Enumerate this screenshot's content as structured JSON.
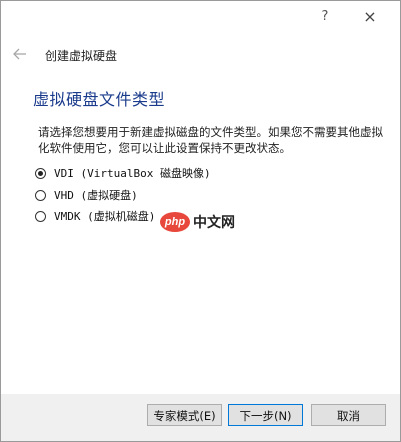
{
  "titlebar": {
    "help_label": "?",
    "close_label": "×"
  },
  "header": {
    "back_icon": "back-arrow-icon",
    "title": "创建虚拟硬盘"
  },
  "main": {
    "heading": "虚拟硬盘文件类型",
    "description": "请选择您想要用于新建虚拟磁盘的文件类型。如果您不需要其他虚拟化软件使用它，您可以让此设置保持不更改状态。",
    "options": [
      {
        "label": "VDI (VirtualBox 磁盘映像)",
        "checked": true
      },
      {
        "label": "VHD (虚拟硬盘)",
        "checked": false
      },
      {
        "label": "VMDK (虚拟机磁盘)",
        "checked": false
      }
    ]
  },
  "watermark": {
    "logo_text": "php",
    "text": "中文网"
  },
  "footer": {
    "expert_label": "专家模式(E)",
    "next_label": "下一步(N)",
    "cancel_label": "取消"
  },
  "colors": {
    "heading": "#1a3b8c",
    "primary_border": "#0078d7",
    "watermark_logo": "#e8483b"
  }
}
